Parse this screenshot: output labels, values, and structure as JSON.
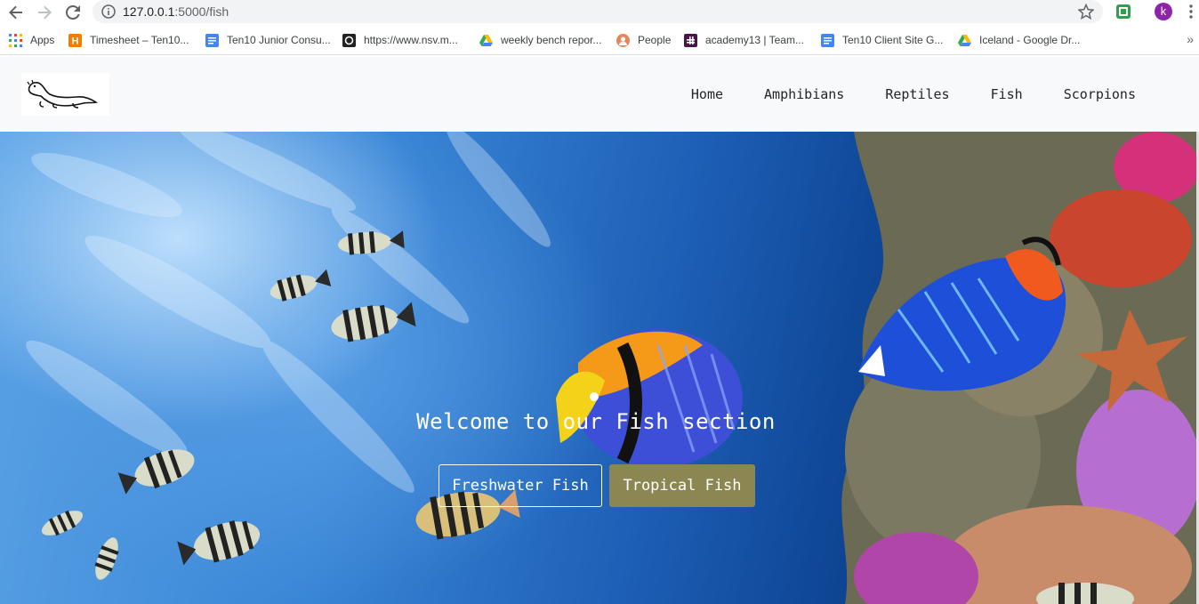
{
  "browser": {
    "url_host": "127.0.0.1",
    "url_path": ":5000/fish",
    "profile_initial": "k",
    "colors": {
      "profile": "#8e24aa"
    }
  },
  "bookmarks": [
    {
      "label": "Apps",
      "icon": "apps-grid-icon"
    },
    {
      "label": "Timesheet – Ten10...",
      "icon": "timesheet-icon"
    },
    {
      "label": "Ten10 Junior Consu...",
      "icon": "google-docs-icon"
    },
    {
      "label": "https://www.nsv.m...",
      "icon": "nsv-icon"
    },
    {
      "label": "weekly bench repor...",
      "icon": "google-drive-icon"
    },
    {
      "label": "People",
      "icon": "people-icon"
    },
    {
      "label": "academy13 | Team...",
      "icon": "slack-icon"
    },
    {
      "label": "Ten10 Client Site G...",
      "icon": "google-docs-icon"
    },
    {
      "label": "Iceland - Google Dr...",
      "icon": "google-drive-icon"
    }
  ],
  "site": {
    "logo": "otter-logo",
    "nav": [
      "Home",
      "Amphibians",
      "Reptiles",
      "Fish",
      "Scorpions"
    ]
  },
  "hero": {
    "title": "Welcome to our Fish section",
    "buttons": {
      "freshwater": "Freshwater Fish",
      "tropical": "Tropical Fish"
    },
    "colors": {
      "tropical_button": "#8c8752"
    }
  }
}
